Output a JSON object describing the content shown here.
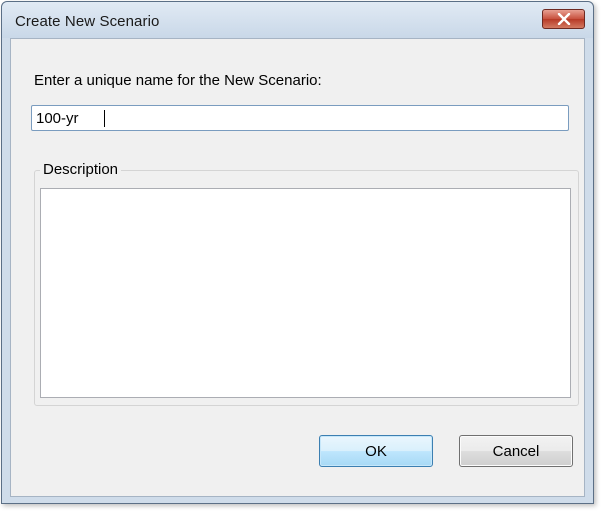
{
  "dialog": {
    "title": "Create New Scenario",
    "close_icon": "close-x-icon"
  },
  "form": {
    "prompt_label": "Enter a unique name for the New Scenario:",
    "name_value": "100-yr",
    "description_legend": "Description",
    "description_value": ""
  },
  "buttons": {
    "ok_label": "OK",
    "cancel_label": "Cancel"
  },
  "colors": {
    "close_button_red": "#c7503d",
    "ok_button_border": "#3c7fb1",
    "window_frame": "#cfdcea"
  }
}
